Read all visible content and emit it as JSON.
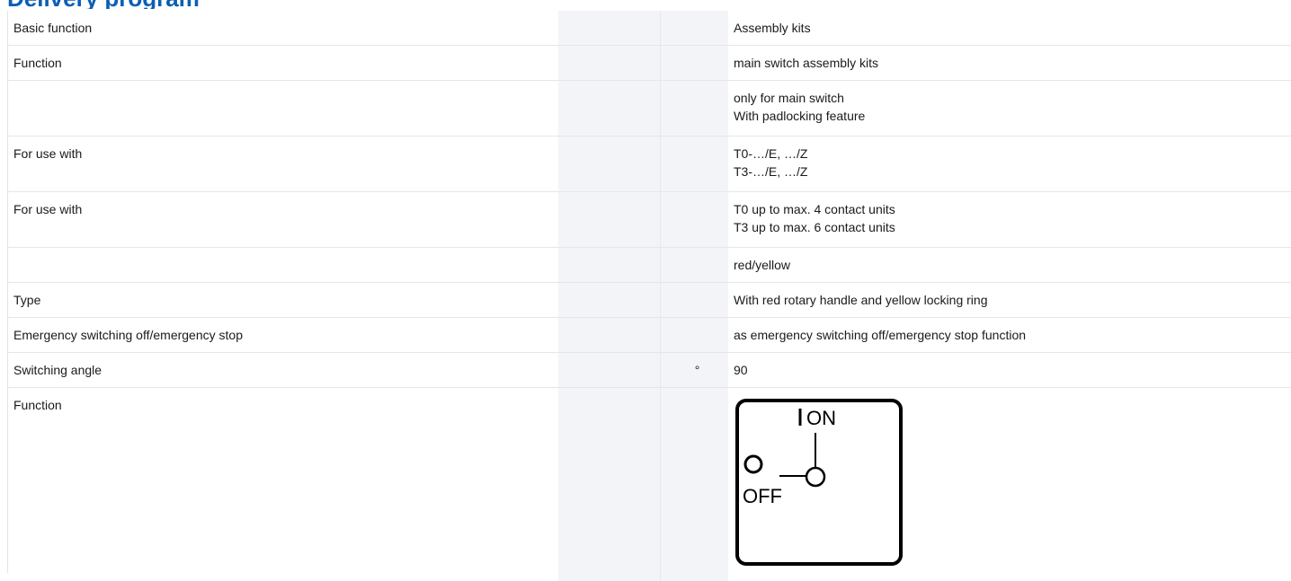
{
  "header": {
    "title": "Delivery program"
  },
  "rows": [
    {
      "label": "Basic function",
      "unit": "",
      "values": [
        "Assembly kits"
      ]
    },
    {
      "label": "Function",
      "unit": "",
      "values": [
        "main switch assembly kits"
      ]
    },
    {
      "label": "",
      "unit": "",
      "values": [
        "only for main switch",
        "With padlocking feature"
      ]
    },
    {
      "label": "For use with",
      "unit": "",
      "values": [
        "T0-…/E, …/Z",
        "T3-…/E, …/Z"
      ]
    },
    {
      "label": "For use with",
      "unit": "",
      "values": [
        "T0 up to max. 4 contact units",
        "T3 up to max. 6 contact units"
      ]
    },
    {
      "label": "",
      "unit": "",
      "values": [
        "red/yellow"
      ]
    },
    {
      "label": "Type",
      "unit": "",
      "values": [
        "With red rotary handle and yellow locking ring"
      ]
    },
    {
      "label": "Emergency switching off/emergency stop",
      "unit": "",
      "values": [
        "as emergency switching off/emergency stop function"
      ]
    },
    {
      "label": "Switching angle",
      "unit": "°",
      "values": [
        "90"
      ]
    },
    {
      "label": "Function",
      "unit": "",
      "values": []
    }
  ],
  "diagram": {
    "on_label": "ON",
    "off_label": "OFF"
  }
}
